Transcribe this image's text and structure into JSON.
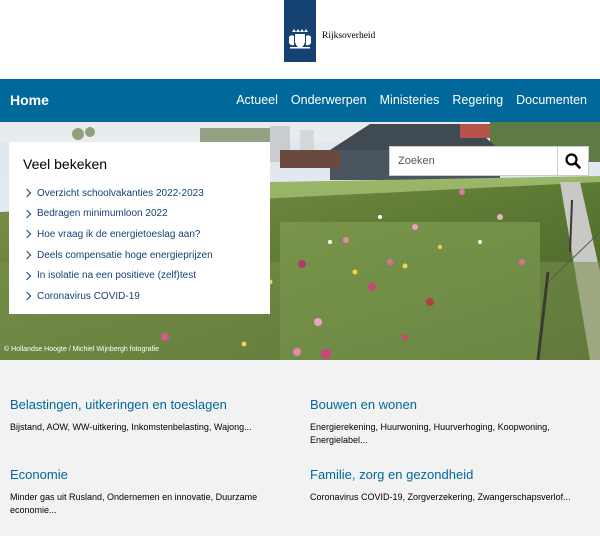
{
  "header": {
    "logo_text": "Rijksoverheid"
  },
  "nav": {
    "home": "Home",
    "items": [
      "Actueel",
      "Onderwerpen",
      "Ministeries",
      "Regering",
      "Documenten"
    ]
  },
  "hero": {
    "photo_credit": "© Hollandse Hoogte / Michiel Wijnbergh fotografie"
  },
  "popular": {
    "title": "Veel bekeken",
    "items": [
      "Overzicht schoolvakanties 2022-2023",
      "Bedragen minimumloon 2022",
      "Hoe vraag ik de energietoeslag aan?",
      "Deels compensatie hoge energieprijzen",
      "In isolatie na een positieve (zelf)test",
      "Coronavirus COVID-19"
    ]
  },
  "search": {
    "placeholder": "Zoeken",
    "icon": "search-icon"
  },
  "topics": [
    {
      "title": "Belastingen, uitkeringen en toeslagen",
      "desc": "Bijstand, AOW, WW-uitkering, Inkomstenbelasting, Wajong..."
    },
    {
      "title": "Bouwen en wonen",
      "desc": "Energierekening, Huurwoning, Huurverhoging, Koopwoning, Energielabel..."
    },
    {
      "title": "Economie",
      "desc": "Minder gas uit Rusland, Ondernemen en innovatie, Duurzame economie..."
    },
    {
      "title": "Familie, zorg en gezondheid",
      "desc": "Coronavirus COVID-19, Zorgverzekering, Zwangerschapsverlof..."
    }
  ],
  "colors": {
    "brand_blue": "#01689b",
    "logo_blue": "#154273",
    "topic_bg": "#f2f2f2"
  }
}
